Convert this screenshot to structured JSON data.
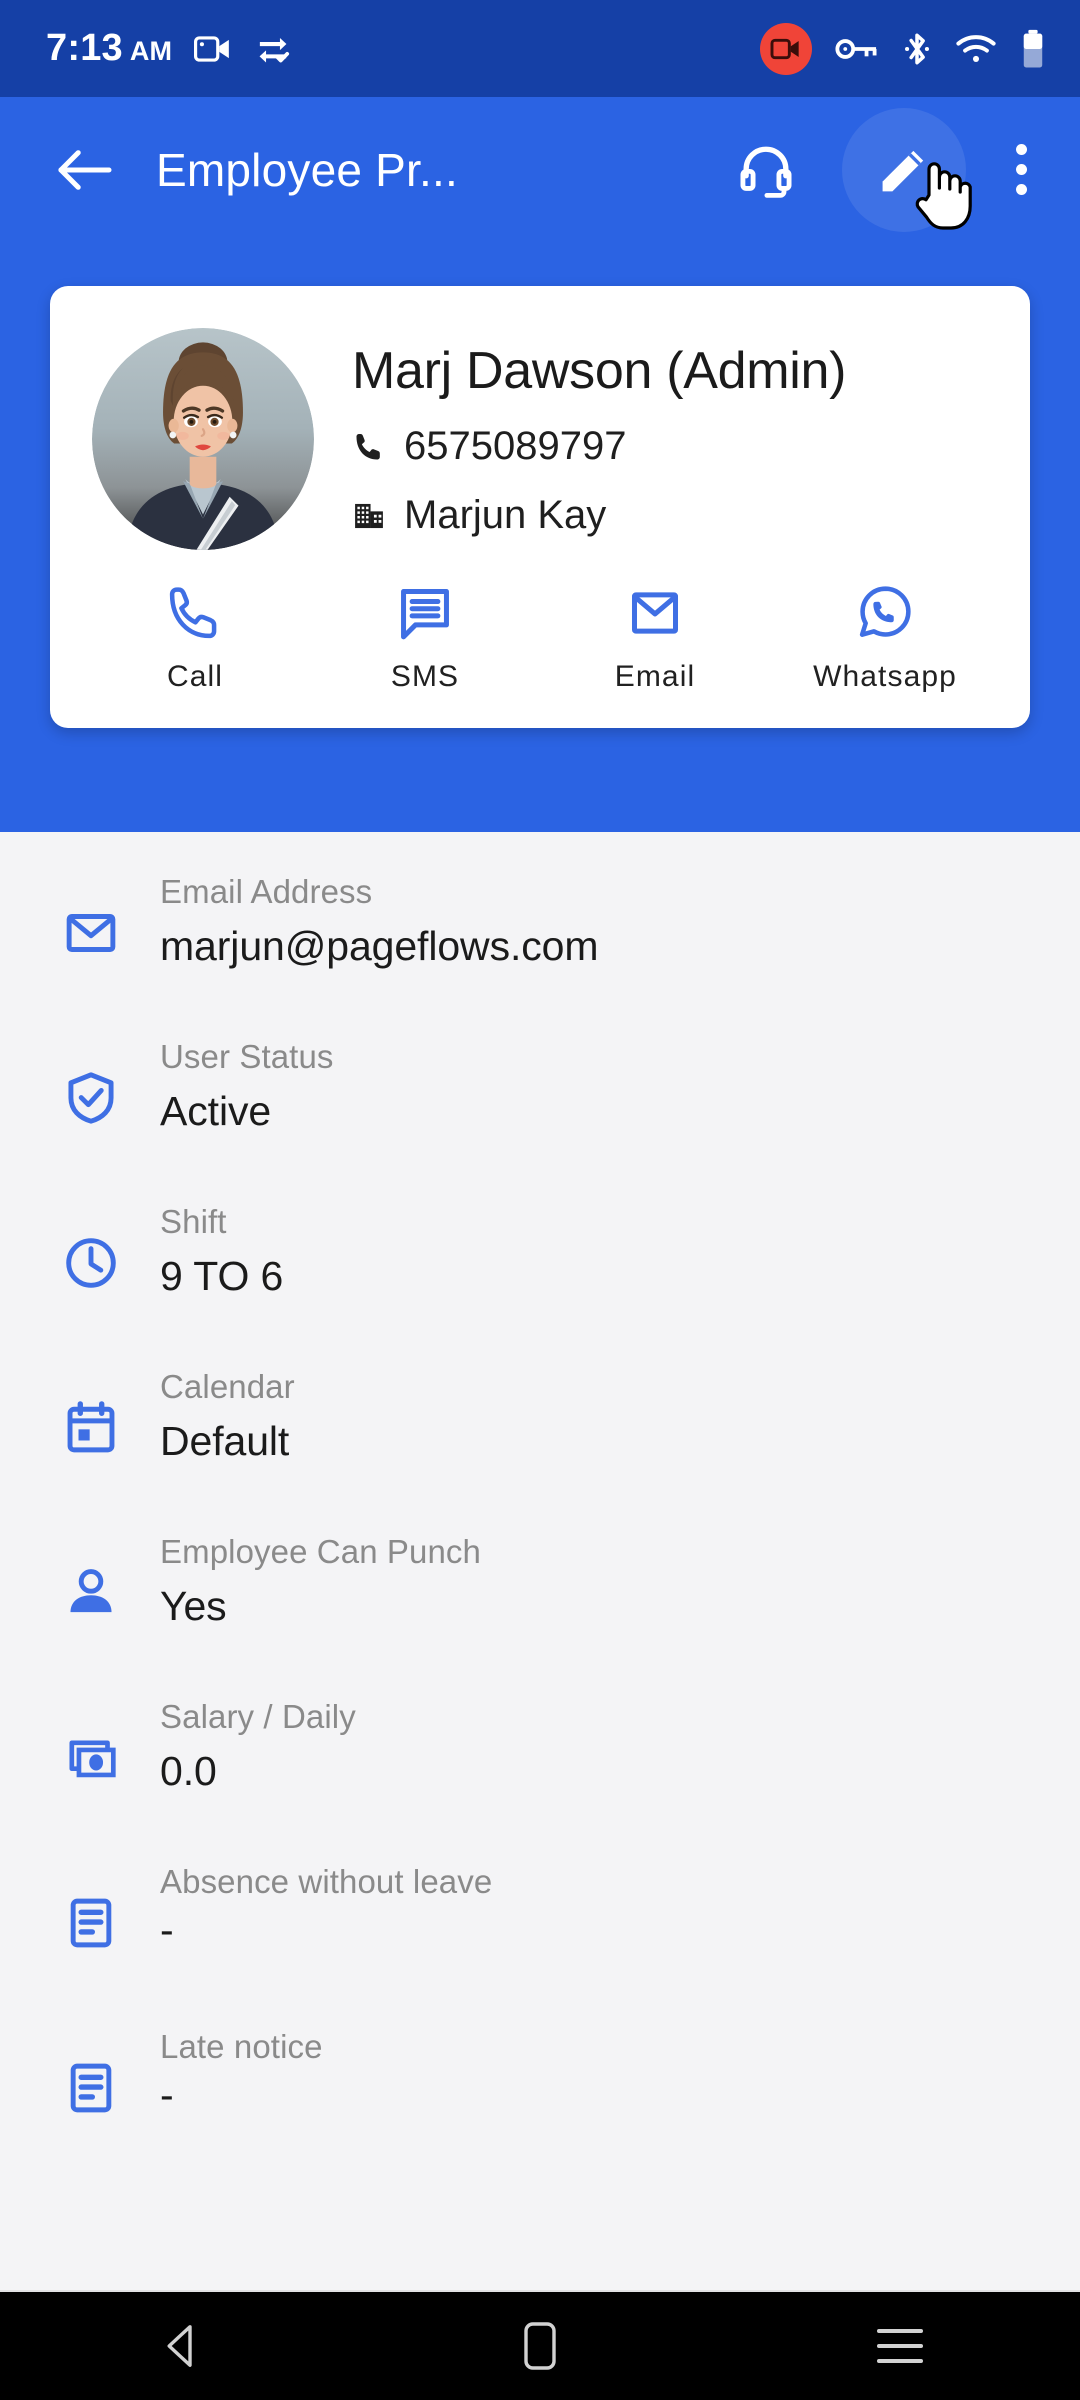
{
  "status_bar": {
    "time": "7:13",
    "meridiem": "AM",
    "icons": [
      "screen-record-icon",
      "data-saver-icon",
      "screen-recording-badge-icon",
      "vpn-key-icon",
      "bluetooth-icon",
      "wifi-icon",
      "battery-icon"
    ]
  },
  "app_bar": {
    "back_label": "back-arrow-icon",
    "title": "Employee Pr...",
    "support_label": "headset-icon",
    "edit_label": "edit-pencil-icon",
    "overflow_label": "more-vert-icon"
  },
  "profile": {
    "name": "Marj Dawson (Admin)",
    "phone": "6575089797",
    "company": "Marjun Kay",
    "avatar_alt": "employee-avatar"
  },
  "quick_actions": [
    {
      "label": "Call",
      "icon": "phone-icon"
    },
    {
      "label": "SMS",
      "icon": "sms-chat-icon"
    },
    {
      "label": "Email",
      "icon": "email-envelope-icon"
    },
    {
      "label": "Whatsapp",
      "icon": "whatsapp-icon"
    }
  ],
  "details": [
    {
      "label": "Email Address",
      "value": "marjun@pageflows.com",
      "icon": "email-envelope-icon"
    },
    {
      "label": "User Status",
      "value": "Active",
      "icon": "shield-check-icon"
    },
    {
      "label": "Shift",
      "value": "9 TO 6",
      "icon": "clock-icon"
    },
    {
      "label": "Calendar",
      "value": "Default",
      "icon": "calendar-icon"
    },
    {
      "label": "Employee Can Punch",
      "value": "Yes",
      "icon": "person-icon"
    },
    {
      "label": "Salary / Daily",
      "value": "0.0",
      "icon": "money-stack-icon"
    },
    {
      "label": "Absence without leave",
      "value": "-",
      "icon": "article-document-icon"
    },
    {
      "label": "Late notice",
      "value": "-",
      "icon": "article-document-icon"
    }
  ],
  "nav_bar": {
    "back": "nav-back-icon",
    "home": "nav-home-icon",
    "recents": "nav-recents-icon"
  },
  "colors": {
    "status_bar_blue": "#1540A6",
    "app_bar_blue": "#2B63E3",
    "accent_blue": "#3F6FE4",
    "page_background": "#F4F4F6",
    "card_white": "#FFFFFF",
    "label_grey": "#8A8A8A",
    "value_black": "#1B1B1B",
    "record_red": "#F04438",
    "nav_black": "#000000"
  }
}
